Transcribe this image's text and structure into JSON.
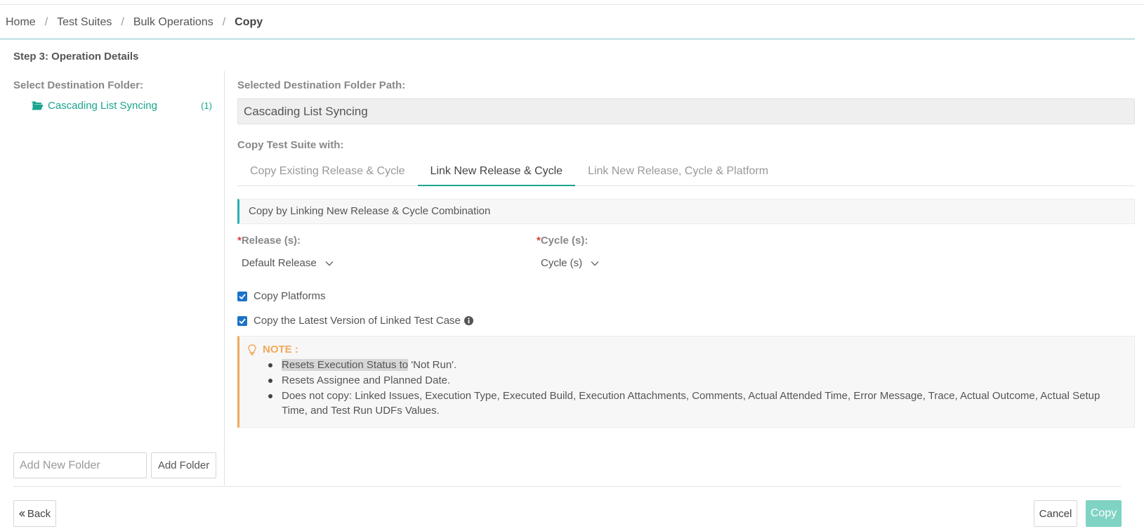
{
  "breadcrumb": {
    "home": "Home",
    "test_suites": "Test Suites",
    "bulk_operations": "Bulk Operations",
    "current": "Copy",
    "separator": "/"
  },
  "step_title": "Step 3: Operation Details",
  "left_panel": {
    "label": "Select Destination Folder:",
    "folder": {
      "name": "Cascading List Syncing",
      "count": "(1)",
      "icon": "folder-open-icon"
    },
    "new_folder_placeholder": "Add New Folder",
    "add_folder_label": "Add Folder"
  },
  "right_panel": {
    "path_label": "Selected Destination Folder Path:",
    "path_value": "Cascading List Syncing",
    "copy_with_label": "Copy Test Suite with:",
    "tabs": [
      {
        "label": "Copy Existing Release & Cycle",
        "active": false
      },
      {
        "label": "Link New Release & Cycle",
        "active": true
      },
      {
        "label": "Link New Release, Cycle & Platform",
        "active": false
      }
    ],
    "info_text": "Copy by Linking New Release & Cycle Combination",
    "release": {
      "required_mark": "*",
      "label": "Release (s):",
      "value": "Default Release"
    },
    "cycle": {
      "required_mark": "*",
      "label": "Cycle (s):",
      "value": "Cycle (s)"
    },
    "copy_platforms": {
      "label": "Copy Platforms",
      "checked": true
    },
    "copy_latest_version": {
      "label": "Copy the Latest Version of Linked Test Case",
      "checked": true
    },
    "note": {
      "title": "NOTE :",
      "item1_highlight": "Resets Execution Status to",
      "item1_rest": " 'Not Run'.",
      "item2": "Resets Assignee and Planned Date.",
      "item3": "Does not copy: Linked Issues, Execution Type, Executed Build, Execution Attachments, Comments, Actual Attended Time, Error Message, Trace, Actual Outcome, Actual Setup Time, and Test Run UDFs Values."
    }
  },
  "footer": {
    "back_label": "Back",
    "cancel_label": "Cancel",
    "copy_label": "Copy"
  },
  "colors": {
    "accent_green": "#1aa58e",
    "copy_button": "#7fd3c3",
    "note_border": "#f3a85a",
    "info_border": "#27b0b8",
    "checkbox": "#1a73c9"
  }
}
